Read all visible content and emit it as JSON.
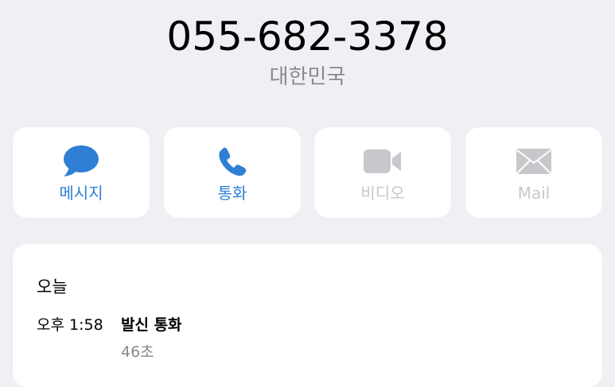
{
  "contact": {
    "phone_number": "055-682-3378",
    "country": "대한민국"
  },
  "actions": [
    {
      "label": "메시지",
      "icon": "message-bubble-icon",
      "enabled": true
    },
    {
      "label": "통화",
      "icon": "phone-icon",
      "enabled": true
    },
    {
      "label": "비디오",
      "icon": "video-camera-icon",
      "enabled": false
    },
    {
      "label": "Mail",
      "icon": "mail-envelope-icon",
      "enabled": false
    }
  ],
  "recents": {
    "day": "오늘",
    "entries": [
      {
        "time": "오후 1:58",
        "type": "발신 통화",
        "duration": "46초"
      }
    ]
  },
  "colors": {
    "background": "#efeff4",
    "accent": "#2f7fd4",
    "disabled": "#c8c8cc",
    "secondary_text": "#8a8a8e"
  }
}
